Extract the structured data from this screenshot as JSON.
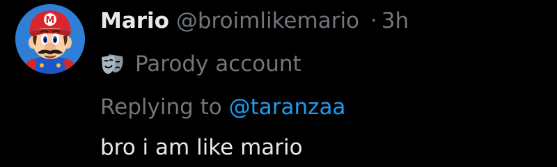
{
  "user": {
    "display_name": "Mario",
    "handle": "@broimlikemario",
    "separator": "·",
    "time": "3h"
  },
  "label": {
    "icon": "parody-mask-icon",
    "text": "Parody account"
  },
  "reply": {
    "prefix": "Replying to ",
    "mention": "@taranzaa"
  },
  "tweet": {
    "text": "bro i am like mario"
  },
  "colors": {
    "background": "#000000",
    "primary_text": "#e7e9ea",
    "secondary_text": "#71767b",
    "link": "#1d9bf0"
  }
}
